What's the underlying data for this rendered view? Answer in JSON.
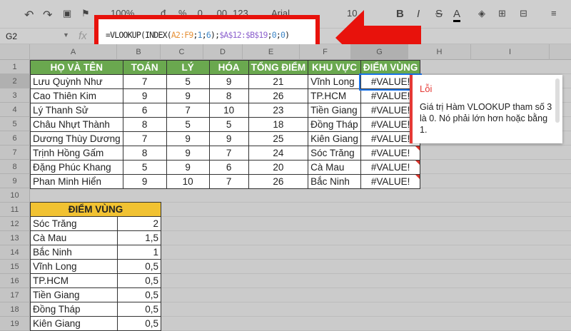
{
  "toolbar": {
    "zoom": "100%",
    "currency": "đ",
    "percent": "%",
    "dec_less": ".0",
    "dec_more": ".00",
    "format": "123",
    "font": "Arial",
    "size": "10",
    "bold": "B",
    "italic": "I",
    "strike": "S",
    "textcolor": "A"
  },
  "formula_bar": {
    "cell_ref": "G2",
    "fx": "fx",
    "formula_parts": [
      {
        "t": "=VLOOKUP(INDEX(",
        "c": "#222"
      },
      {
        "t": "A2:F9",
        "c": "#e69138"
      },
      {
        "t": ";",
        "c": "#222"
      },
      {
        "t": "1",
        "c": "#3d85c6"
      },
      {
        "t": ";",
        "c": "#222"
      },
      {
        "t": "6",
        "c": "#3d85c6"
      },
      {
        "t": ");",
        "c": "#222"
      },
      {
        "t": "$A$12:$B$19",
        "c": "#8e63ce"
      },
      {
        "t": ";",
        "c": "#222"
      },
      {
        "t": "0",
        "c": "#3d85c6"
      },
      {
        "t": ";",
        "c": "#222"
      },
      {
        "t": "0",
        "c": "#3d85c6"
      },
      {
        "t": ")",
        "c": "#222"
      }
    ]
  },
  "columns": [
    "A",
    "B",
    "C",
    "D",
    "E",
    "F",
    "G",
    "H",
    "I"
  ],
  "rows": [
    "1",
    "2",
    "3",
    "4",
    "5",
    "6",
    "7",
    "8",
    "9",
    "10",
    "11",
    "12",
    "13",
    "14",
    "15",
    "16",
    "17",
    "18",
    "19"
  ],
  "main_table": {
    "headers": [
      "HỌ VÀ TÊN",
      "TOÁN",
      "LÝ",
      "HÓA",
      "TỔNG ĐIỂM",
      "KHU VỰC",
      "ĐIỂM VÙNG"
    ],
    "rows": [
      [
        "Lưu Quỳnh Như",
        "7",
        "5",
        "9",
        "21",
        "Vĩnh Long",
        "#VALUE!"
      ],
      [
        "Cao Thiên Kim",
        "9",
        "9",
        "8",
        "26",
        "TP.HCM",
        "#VALUE!"
      ],
      [
        "Lý Thanh Sử",
        "6",
        "7",
        "10",
        "23",
        "Tiền Giang",
        "#VALUE!"
      ],
      [
        "Châu Nhựt Thành",
        "8",
        "5",
        "5",
        "18",
        "Đồng Tháp",
        "#VALUE!"
      ],
      [
        "Dương Thùy Dương",
        "7",
        "9",
        "9",
        "25",
        "Kiên Giang",
        "#VALUE!"
      ],
      [
        "Trịnh Hồng Gấm",
        "8",
        "9",
        "7",
        "24",
        "Sóc Trăng",
        "#VALUE!"
      ],
      [
        "Đặng Phúc Khang",
        "5",
        "9",
        "6",
        "20",
        "Cà Mau",
        "#VALUE!"
      ],
      [
        "Phan Minh Hiển",
        "9",
        "10",
        "7",
        "26",
        "Bắc Ninh",
        "#VALUE!"
      ]
    ]
  },
  "lookup_table": {
    "header": "ĐIỂM VÙNG",
    "rows": [
      [
        "Sóc Trăng",
        "2"
      ],
      [
        "Cà Mau",
        "1,5"
      ],
      [
        "Bắc Ninh",
        "1"
      ],
      [
        "Vĩnh Long",
        "0,5"
      ],
      [
        "TP.HCM",
        "0,5"
      ],
      [
        "Tiền Giang",
        "0,5"
      ],
      [
        "Đồng Tháp",
        "0,5"
      ],
      [
        "Kiên Giang",
        "0,5"
      ]
    ]
  },
  "tooltip": {
    "title": "Lỗi",
    "message": "Giá trị Hàm VLOOKUP tham số 3 là 0. Nó phải lớn hơn hoặc bằng 1."
  },
  "colors": {
    "header_green": "#6aa84f",
    "lookup_yellow": "#f1c232",
    "highlight_red": "#e8120c"
  }
}
